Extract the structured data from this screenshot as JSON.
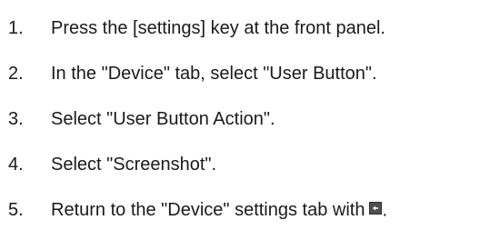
{
  "steps": [
    {
      "number": "1.",
      "text": "Press the [settings] key at the front panel."
    },
    {
      "number": "2.",
      "text": "In the \"Device\" tab, select \"User Button\"."
    },
    {
      "number": "3.",
      "text": "Select \"User Button Action\"."
    },
    {
      "number": "4.",
      "text": "Select \"Screenshot\"."
    },
    {
      "number": "5.",
      "text": "Return to the \"Device\" settings tab with",
      "icon": "back-arrow-key-icon",
      "trailing": "."
    }
  ],
  "colors": {
    "text": "#1a1a1a",
    "key_icon_bg": "#4f4f4f",
    "key_icon_glyph": "#ffffff"
  }
}
